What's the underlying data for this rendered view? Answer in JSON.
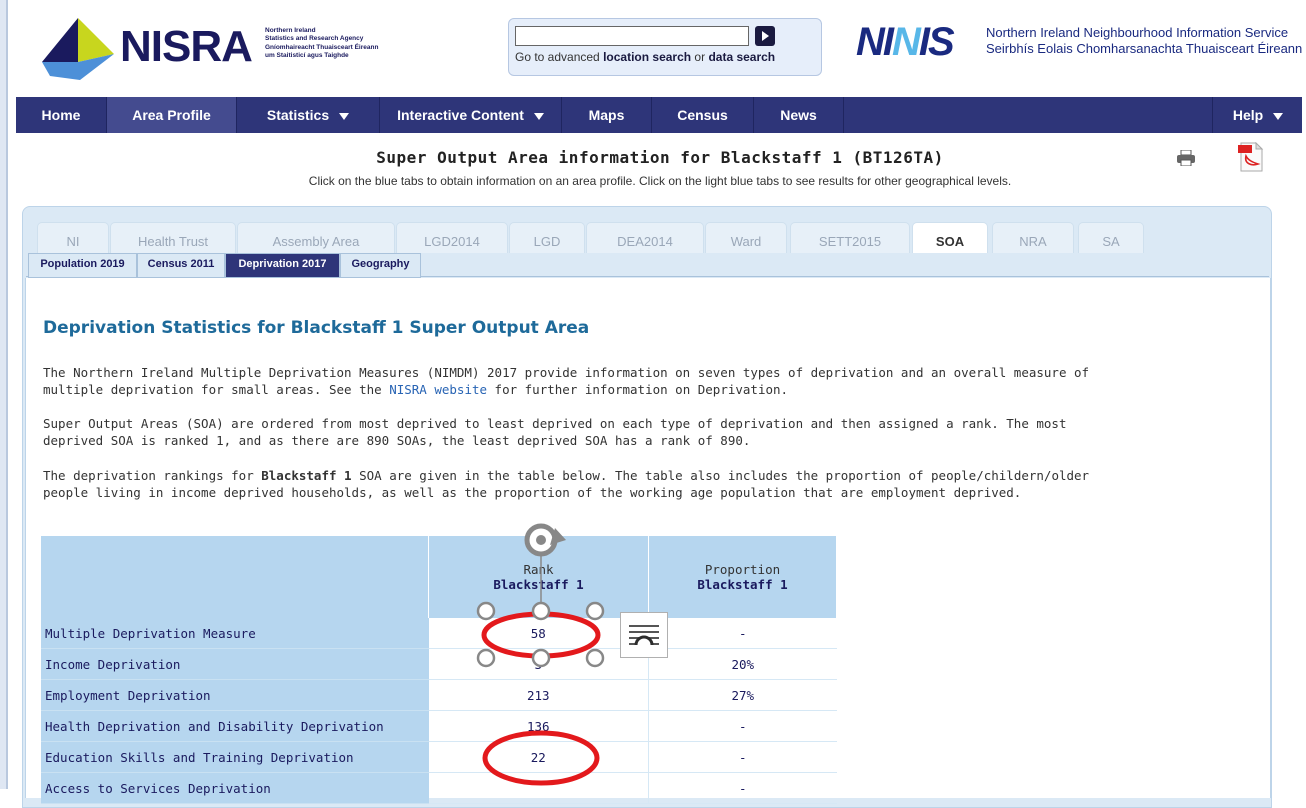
{
  "header": {
    "logo_text": "NISRA",
    "agency_lines": [
      "Northern Ireland",
      "Statistics and Research Agency",
      "Gníomhaireacht Thuaisceart Éireann",
      "um Staitisticí agus Taighde"
    ],
    "search": {
      "value": "",
      "text_prefix": "Go to advanced ",
      "link1": "location search",
      "text_mid": " or ",
      "link2": "data search"
    },
    "ninis_logo": [
      "NI",
      "N",
      "IS"
    ],
    "ninis_tagline": [
      "Northern Ireland Neighbourhood Information Service",
      "Seirbhís Eolais Chomharsanachta Thuaisceart Éireann"
    ]
  },
  "nav": {
    "items": [
      "Home",
      "Area Profile",
      "Statistics",
      "Interactive Content",
      "Maps",
      "Census",
      "News",
      "Help"
    ]
  },
  "page": {
    "title": "Super Output Area information for Blackstaff 1 (BT126TA)",
    "subtitle": "Click on the blue tabs to obtain information on an area profile. Click on the light blue tabs to see results for other geographical levels."
  },
  "geo_tabs": [
    "NI",
    "Health Trust",
    "Assembly Area",
    "LGD2014",
    "LGD",
    "DEA2014",
    "Ward",
    "SETT2015",
    "SOA",
    "NRA",
    "SA"
  ],
  "sub_tabs": [
    "Population 2019",
    "Census 2011",
    "Deprivation 2017",
    "Geography"
  ],
  "content": {
    "heading": "Deprivation Statistics for Blackstaff 1 Super Output Area",
    "para1_a": "The Northern Ireland Multiple Deprivation Measures (NIMDM) 2017 provide information on seven types of deprivation and an overall measure of multiple deprivation for small areas. See the ",
    "para1_link": "NISRA website",
    "para1_b": " for further information on Deprivation.",
    "para2": "Super Output Areas (SOA) are ordered from most deprived to least deprived on each type of deprivation and then assigned a rank. The most deprived SOA is ranked 1, and as there are 890 SOAs, the least deprived SOA has a rank of 890.",
    "para3_a": "The deprivation rankings for ",
    "para3_bold": "Blackstaff 1",
    "para3_b": " SOA are given in the table below. The table also includes the proportion of people/childern/older people living in income deprived households, as well as the proportion of the working age population that are employment deprived."
  },
  "table": {
    "headers": [
      {
        "label": "",
        "area": ""
      },
      {
        "label": "Rank",
        "area": "Blackstaff 1"
      },
      {
        "label": "Proportion",
        "area": "Blackstaff 1"
      }
    ],
    "rows": [
      {
        "measure": "Multiple Deprivation Measure",
        "rank": "58",
        "proportion": "-"
      },
      {
        "measure": "Income Deprivation",
        "rank": "3",
        "proportion": "20%"
      },
      {
        "measure": "Employment Deprivation",
        "rank": "213",
        "proportion": "27%"
      },
      {
        "measure": "Health Deprivation and Disability Deprivation",
        "rank": "136",
        "proportion": "-"
      },
      {
        "measure": "Education Skills and Training Deprivation",
        "rank": "22",
        "proportion": "-"
      },
      {
        "measure": "Access to Services Deprivation",
        "rank": "",
        "proportion": "-"
      }
    ]
  },
  "annotation_colors": {
    "circle": "#e3191c",
    "handle": "#888888"
  }
}
